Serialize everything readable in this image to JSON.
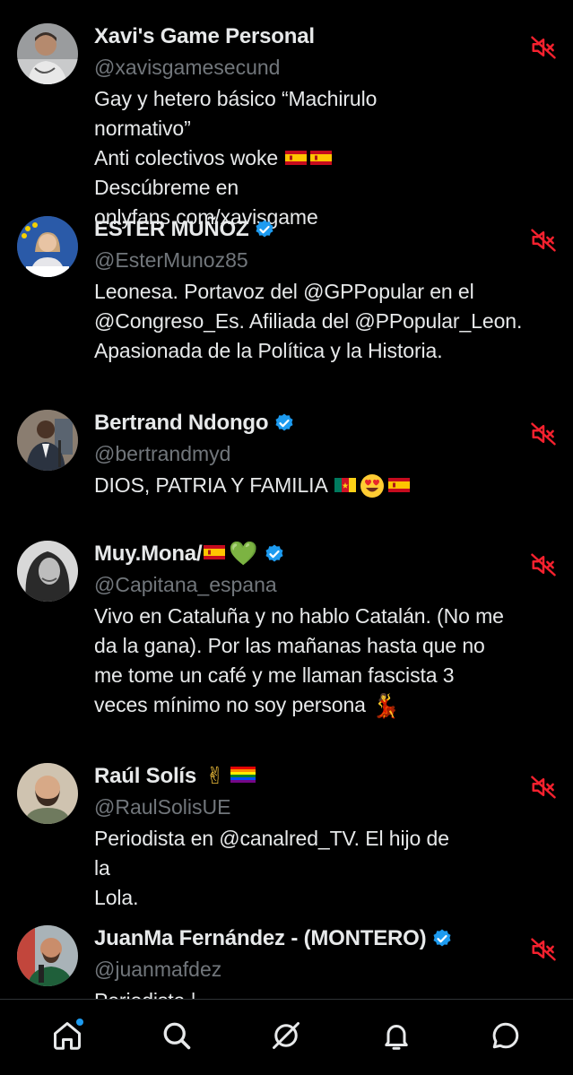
{
  "accounts": [
    {
      "name": "Xavi's Game Personal",
      "handle": "@xavisgamesecund",
      "verified": false,
      "bio_parts": [
        "Gay y hetero básico “Machirulo normativo”\nAnti colectivos woke ",
        "\nDescúbreme en onlyfans.com/xavisgame"
      ],
      "bio_emoji": [
        "flag-es",
        "flag-es"
      ],
      "avatar_icon": "man-portrait-avatar"
    },
    {
      "name": "ESTER MUÑOZ",
      "handle": "@EsterMunoz85",
      "verified": true,
      "bio": "Leonesa. Portavoz del @GPPopular en el\n@Congreso_Es. Afiliada del @PPopular_Leon.\nApasionada de la Política y la Historia.",
      "avatar_icon": "woman-portrait-avatar"
    },
    {
      "name": "Bertrand Ndongo",
      "handle": "@bertrandmyd",
      "verified": true,
      "bio": "DIOS, PATRIA Y FAMILIA",
      "bio_emoji": [
        "flag-cm",
        "smiling-face-with-heart-eyes",
        "flag-es"
      ],
      "avatar_icon": "man-suit-avatar"
    },
    {
      "name": "Muy.Mona/",
      "handle": "@Capitana_espana",
      "verified": true,
      "name_emoji": [
        "flag-es",
        "green-heart"
      ],
      "green_heart": "💚",
      "bio": "Vivo en Cataluña y no hablo Catalán. (No me\nda la gana). Por las mañanas hasta que no\nme tome un café y me llaman fascista 3\nveces mínimo no soy persona ",
      "bio_emoji_char": "💃",
      "avatar_icon": "woman-bw-avatar"
    },
    {
      "name": "Raúl Solís",
      "handle": "@RaulSolisUE",
      "verified": false,
      "name_emoji_char": "✌",
      "name_emoji": [
        "victory-hand",
        "rainbow-flag"
      ],
      "bio": "Periodista en @canalred_TV. El hijo de la\nLola.",
      "avatar_icon": "bearded-man-avatar"
    },
    {
      "name": "JuanMa Fernández - (MONTERO)",
      "handle": "@juanmafdez",
      "verified": true,
      "bio": "Periodista |",
      "avatar_icon": "man-microphone-avatar"
    }
  ],
  "icons": {
    "mute": "speaker-muted-icon",
    "verified": "verified-badge-icon"
  },
  "nav": [
    {
      "name": "home",
      "icon": "home-icon",
      "active": true,
      "notification_dot": true
    },
    {
      "name": "search",
      "icon": "search-icon"
    },
    {
      "name": "grok",
      "icon": "grok-icon"
    },
    {
      "name": "notifications",
      "icon": "bell-icon"
    },
    {
      "name": "messages",
      "icon": "chat-icon"
    }
  ],
  "colors": {
    "background": "#000000",
    "text": "#e7e9ea",
    "secondary_text": "#71767b",
    "mute_red": "#f4212e",
    "verified_blue": "#1d9bf0",
    "divider": "#2f3336"
  }
}
